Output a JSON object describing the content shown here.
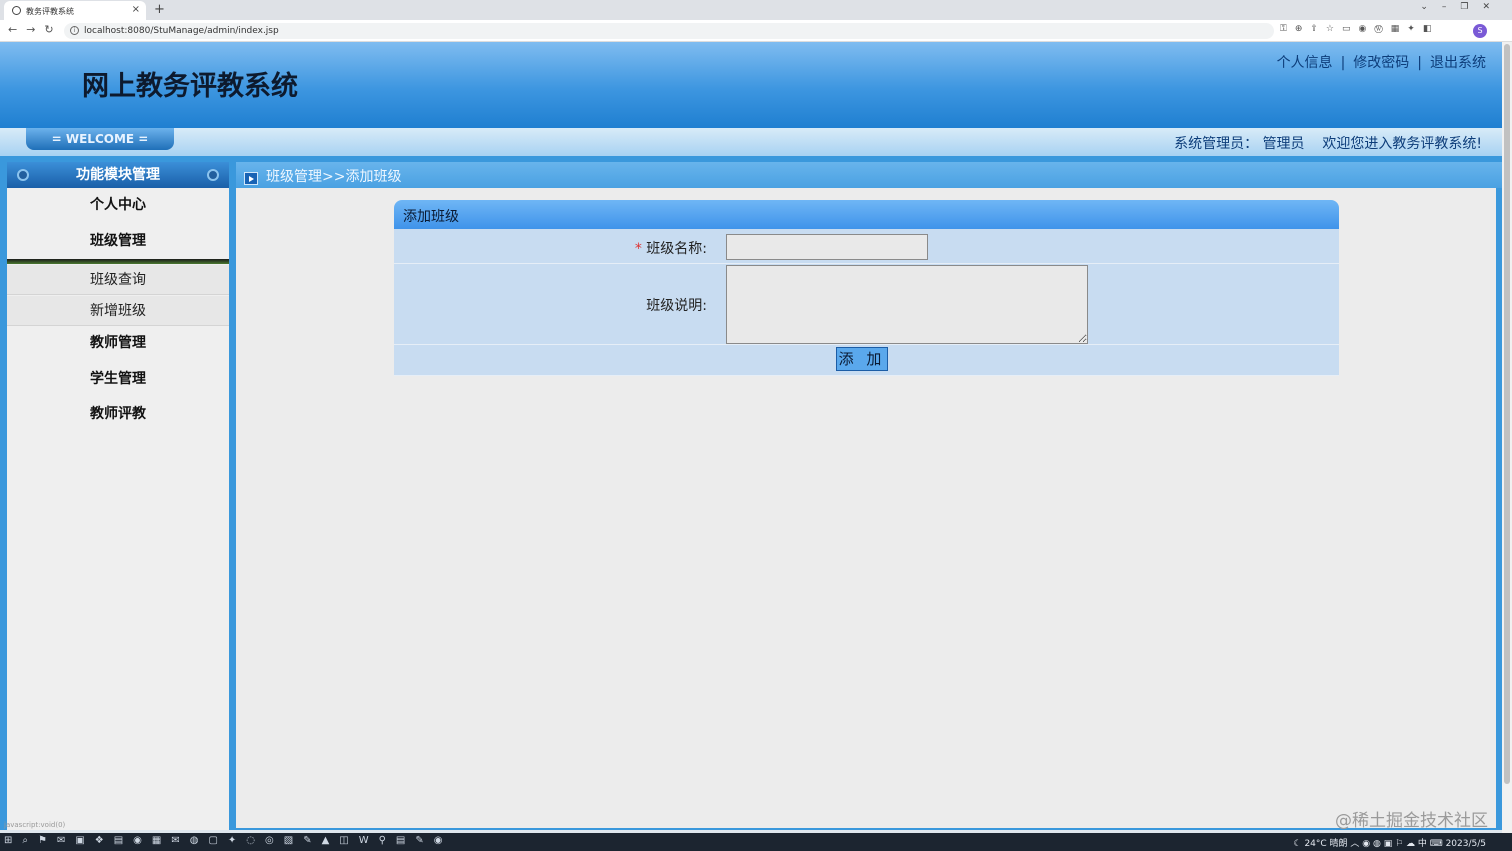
{
  "browser": {
    "tab_title": "教务评教系统",
    "tab_close": "×",
    "new_tab": "+",
    "url": "localhost:8080/StuManage/admin/index.jsp",
    "nav_glyphs": "←→↻",
    "ext_glyphs": "⚿⊕⇪☆▭◉Ⓦ▦✦◧",
    "window_controls": "⌄–❐✕",
    "profile_letter": "S"
  },
  "header": {
    "title": "网上教务评教系统",
    "links": [
      "个人信息",
      "修改密码",
      "退出系统"
    ],
    "separator": "|",
    "welcome_badge": "= WELCOME =",
    "role_label": "系统管理员：",
    "user_name": "管理员",
    "welcome_message": "欢迎您进入教务评教系统!"
  },
  "sidebar": {
    "title": "功能模块管理",
    "menus": [
      "个人中心",
      "班级管理",
      "教师管理",
      "学生管理",
      "教师评教"
    ],
    "submenus": [
      "班级查询",
      "新增班级"
    ]
  },
  "breadcrumb": "班级管理>>添加班级",
  "form": {
    "title": "添加班级",
    "required_mark": "*",
    "name_label": "班级名称:",
    "name_value": "",
    "desc_label": "班级说明:",
    "desc_value": "",
    "submit_label": "添 加"
  },
  "footer": {
    "watermark": "@稀土掘金技术社区",
    "status_hint": "javascript:void(0)"
  },
  "taskbar": {
    "icons": "⊞⌕⚑✉▣❖▤◉▦✉◍▢✦◌◎▧✎▲◫W⚲▤✎◉",
    "tray": "☾ 24°C 晴朗 ︿ ◉ ◍ ▣ ⚐ ☁ 中 ⌨ 2023/5/5"
  },
  "colors": {
    "header_blue": "#3d96e0",
    "frame_blue": "#3a98dc",
    "form_row": "#c8dcf1"
  }
}
